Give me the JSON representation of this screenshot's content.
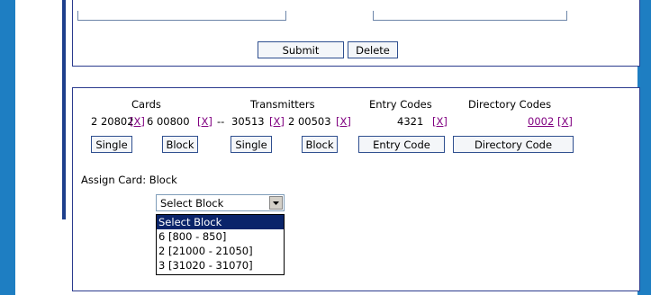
{
  "form_top": {
    "submit_label": "Submit",
    "delete_label": "Delete"
  },
  "codes": {
    "headers": {
      "cards": "Cards",
      "transmitters": "Transmitters",
      "entry_codes": "Entry Codes",
      "directory_codes": "Directory Codes"
    },
    "values": {
      "card_1": "2 20802",
      "card_2": "6 00800",
      "range_sep": "--",
      "transmitter_1": "30513",
      "transmitter_2": "2 00503",
      "entry_code": "4321",
      "directory_code": "0002",
      "remove": "[X]"
    },
    "buttons": {
      "cards_single": "Single",
      "cards_block": "Block",
      "transmitters_single": "Single",
      "transmitters_block": "Block",
      "entry_code": "Entry Code",
      "directory_code": "Directory Code"
    }
  },
  "assign": {
    "label": "Assign Card: Block",
    "selected": "Select Block",
    "options": [
      "Select Block",
      "6 [800 - 850]",
      "2 [21000 - 21050]",
      "3 [31020 - 31070]"
    ],
    "highlighted_index": 0
  },
  "icons": {
    "dropdown": "chevron-down-icon"
  },
  "colors": {
    "background": "#1e7ec2",
    "border": "#2b3b8e",
    "link": "#800080",
    "highlight": "#0a246a"
  }
}
